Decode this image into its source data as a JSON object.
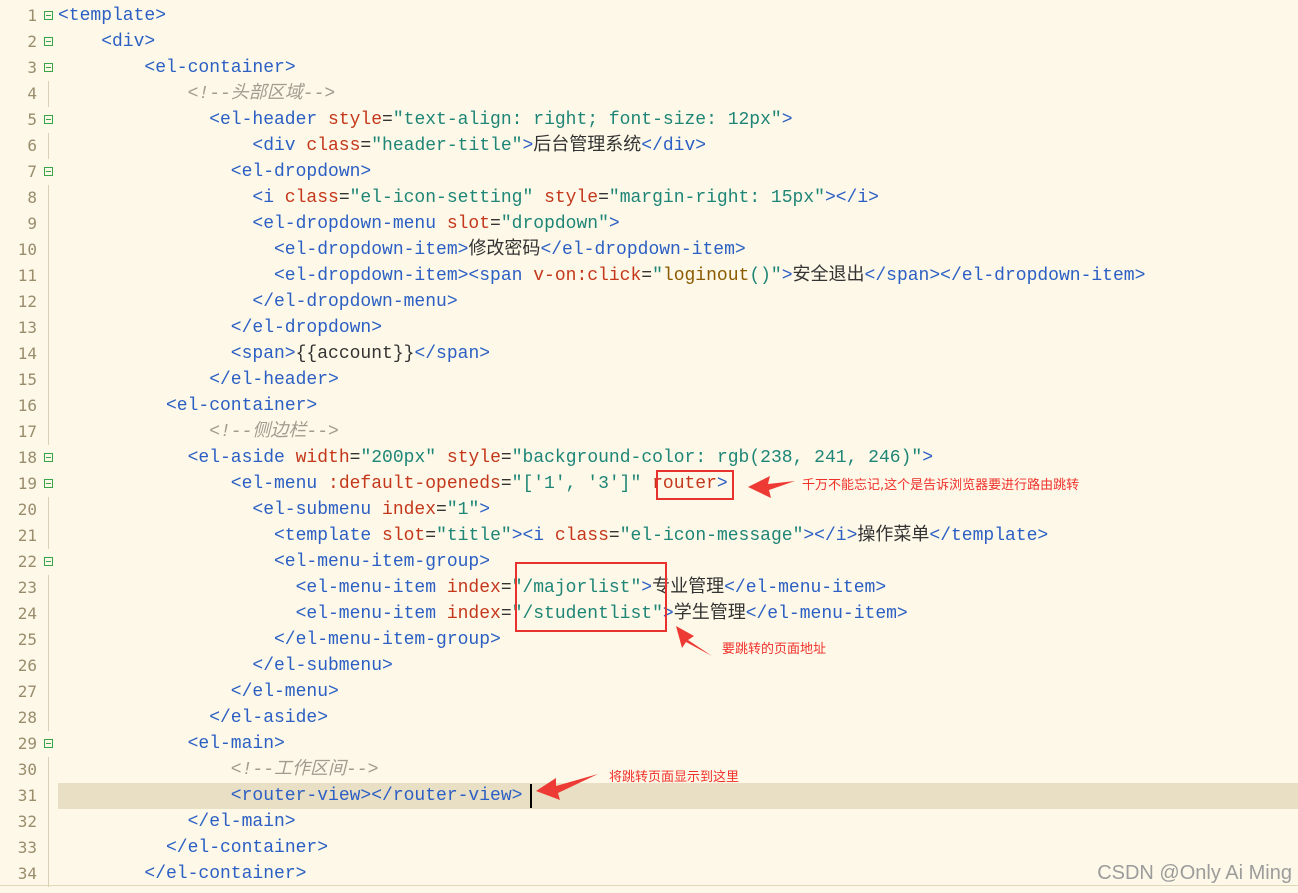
{
  "editor": {
    "current_line": 31,
    "lines": [
      {
        "n": "1",
        "fold": true,
        "indent": 0,
        "tokens": [
          [
            "tag",
            "<template>"
          ]
        ]
      },
      {
        "n": "2",
        "fold": true,
        "indent": 4,
        "tokens": [
          [
            "tag",
            "<div>"
          ]
        ]
      },
      {
        "n": "3",
        "fold": true,
        "indent": 8,
        "tokens": [
          [
            "tag",
            "<el-container>"
          ]
        ]
      },
      {
        "n": "4",
        "fold": false,
        "indent": 12,
        "tokens": [
          [
            "com",
            "<!--头部区域-->"
          ]
        ]
      },
      {
        "n": "5",
        "fold": true,
        "indent": 14,
        "tokens": [
          [
            "tag",
            "<el-header "
          ],
          [
            "attr",
            "style"
          ],
          [
            "txt",
            "="
          ],
          [
            "str",
            "\"text-align: right; font-size: 12px\""
          ],
          [
            "tag",
            ">"
          ]
        ]
      },
      {
        "n": "6",
        "fold": false,
        "indent": 18,
        "tokens": [
          [
            "tag",
            "<div "
          ],
          [
            "attr",
            "class"
          ],
          [
            "txt",
            "="
          ],
          [
            "str",
            "\"header-title\""
          ],
          [
            "tag",
            ">"
          ],
          [
            "txt",
            "后台管理系统"
          ],
          [
            "tag",
            "</div>"
          ]
        ]
      },
      {
        "n": "7",
        "fold": true,
        "indent": 16,
        "tokens": [
          [
            "tag",
            "<el-dropdown>"
          ]
        ]
      },
      {
        "n": "8",
        "fold": false,
        "indent": 18,
        "tokens": [
          [
            "tag",
            "<i "
          ],
          [
            "attr",
            "class"
          ],
          [
            "txt",
            "="
          ],
          [
            "str",
            "\"el-icon-setting\""
          ],
          [
            "tag",
            " "
          ],
          [
            "attr",
            "style"
          ],
          [
            "txt",
            "="
          ],
          [
            "str",
            "\"margin-right: 15px\""
          ],
          [
            "tag",
            "></i>"
          ]
        ]
      },
      {
        "n": "9",
        "fold": false,
        "indent": 18,
        "tokens": [
          [
            "tag",
            "<el-dropdown-menu "
          ],
          [
            "attr",
            "slot"
          ],
          [
            "txt",
            "="
          ],
          [
            "str",
            "\"dropdown\""
          ],
          [
            "tag",
            ">"
          ]
        ]
      },
      {
        "n": "10",
        "fold": false,
        "indent": 20,
        "tokens": [
          [
            "tag",
            "<el-dropdown-item>"
          ],
          [
            "txt",
            "修改密码"
          ],
          [
            "tag",
            "</el-dropdown-item>"
          ]
        ]
      },
      {
        "n": "11",
        "fold": false,
        "indent": 20,
        "tokens": [
          [
            "tag",
            "<el-dropdown-item><span "
          ],
          [
            "attr",
            "v-on:click"
          ],
          [
            "txt",
            "="
          ],
          [
            "str",
            "\""
          ],
          [
            "fn",
            "loginout"
          ],
          [
            "str",
            "()\""
          ],
          [
            "tag",
            ">"
          ],
          [
            "txt",
            "安全退出"
          ],
          [
            "tag",
            "</span></el-dropdown-item>"
          ]
        ]
      },
      {
        "n": "12",
        "fold": false,
        "indent": 18,
        "tokens": [
          [
            "tag",
            "</el-dropdown-menu>"
          ]
        ]
      },
      {
        "n": "13",
        "fold": false,
        "indent": 16,
        "tokens": [
          [
            "tag",
            "</el-dropdown>"
          ]
        ]
      },
      {
        "n": "14",
        "fold": false,
        "indent": 16,
        "tokens": [
          [
            "tag",
            "<span>"
          ],
          [
            "txt",
            "{{account}}"
          ],
          [
            "tag",
            "</span>"
          ]
        ]
      },
      {
        "n": "15",
        "fold": false,
        "indent": 14,
        "tokens": [
          [
            "tag",
            "</el-header>"
          ]
        ]
      },
      {
        "n": "16",
        "fold": false,
        "indent": 10,
        "tokens": [
          [
            "tag",
            "<el-container>"
          ]
        ]
      },
      {
        "n": "17",
        "fold": false,
        "indent": 14,
        "tokens": [
          [
            "com",
            "<!--侧边栏-->"
          ]
        ]
      },
      {
        "n": "18",
        "fold": true,
        "indent": 12,
        "tokens": [
          [
            "tag",
            "<el-aside "
          ],
          [
            "attr",
            "width"
          ],
          [
            "txt",
            "="
          ],
          [
            "str",
            "\"200px\""
          ],
          [
            "tag",
            " "
          ],
          [
            "attr",
            "style"
          ],
          [
            "txt",
            "="
          ],
          [
            "str",
            "\"background-color: rgb(238, 241, 246)\""
          ],
          [
            "tag",
            ">"
          ]
        ]
      },
      {
        "n": "19",
        "fold": true,
        "indent": 16,
        "tokens": [
          [
            "tag",
            "<el-menu "
          ],
          [
            "attr",
            ":default-openeds"
          ],
          [
            "txt",
            "="
          ],
          [
            "str",
            "\"['1', '3']\""
          ],
          [
            "tag",
            " "
          ],
          [
            "attr",
            "router"
          ],
          [
            "tag",
            ">"
          ]
        ]
      },
      {
        "n": "20",
        "fold": false,
        "indent": 18,
        "tokens": [
          [
            "tag",
            "<el-submenu "
          ],
          [
            "attr",
            "index"
          ],
          [
            "txt",
            "="
          ],
          [
            "str",
            "\"1\""
          ],
          [
            "tag",
            ">"
          ]
        ]
      },
      {
        "n": "21",
        "fold": false,
        "indent": 20,
        "tokens": [
          [
            "tag",
            "<template "
          ],
          [
            "attr",
            "slot"
          ],
          [
            "txt",
            "="
          ],
          [
            "str",
            "\"title\""
          ],
          [
            "tag",
            "><i "
          ],
          [
            "attr",
            "class"
          ],
          [
            "txt",
            "="
          ],
          [
            "str",
            "\"el-icon-message\""
          ],
          [
            "tag",
            "></i>"
          ],
          [
            "txt",
            "操作菜单"
          ],
          [
            "tag",
            "</template>"
          ]
        ]
      },
      {
        "n": "22",
        "fold": true,
        "indent": 20,
        "tokens": [
          [
            "tag",
            "<el-menu-item-group>"
          ]
        ]
      },
      {
        "n": "23",
        "fold": false,
        "indent": 22,
        "tokens": [
          [
            "tag",
            "<el-menu-item "
          ],
          [
            "attr",
            "index"
          ],
          [
            "txt",
            "="
          ],
          [
            "str",
            "\"/majorlist\""
          ],
          [
            "tag",
            ">"
          ],
          [
            "txt",
            "专业管理"
          ],
          [
            "tag",
            "</el-menu-item>"
          ]
        ]
      },
      {
        "n": "24",
        "fold": false,
        "indent": 22,
        "tokens": [
          [
            "tag",
            "<el-menu-item "
          ],
          [
            "attr",
            "index"
          ],
          [
            "txt",
            "="
          ],
          [
            "str",
            "\"/studentlist\""
          ],
          [
            "tag",
            ">"
          ],
          [
            "txt",
            "学生管理"
          ],
          [
            "tag",
            "</el-menu-item>"
          ]
        ]
      },
      {
        "n": "25",
        "fold": false,
        "indent": 20,
        "tokens": [
          [
            "tag",
            "</el-menu-item-group>"
          ]
        ]
      },
      {
        "n": "26",
        "fold": false,
        "indent": 18,
        "tokens": [
          [
            "tag",
            "</el-submenu>"
          ]
        ]
      },
      {
        "n": "27",
        "fold": false,
        "indent": 16,
        "tokens": [
          [
            "tag",
            "</el-menu>"
          ]
        ]
      },
      {
        "n": "28",
        "fold": false,
        "indent": 14,
        "tokens": [
          [
            "tag",
            "</el-aside>"
          ]
        ]
      },
      {
        "n": "29",
        "fold": true,
        "indent": 12,
        "tokens": [
          [
            "tag",
            "<el-main>"
          ]
        ]
      },
      {
        "n": "30",
        "fold": false,
        "indent": 16,
        "tokens": [
          [
            "com",
            "<!--工作区间-->"
          ]
        ]
      },
      {
        "n": "31",
        "fold": false,
        "indent": 16,
        "tokens": [
          [
            "tag",
            "<router-view></router-view>"
          ]
        ]
      },
      {
        "n": "32",
        "fold": false,
        "indent": 12,
        "tokens": [
          [
            "tag",
            "</el-main>"
          ]
        ]
      },
      {
        "n": "33",
        "fold": false,
        "indent": 10,
        "tokens": [
          [
            "tag",
            "</el-container>"
          ]
        ]
      },
      {
        "n": "34",
        "fold": false,
        "indent": 8,
        "tokens": [
          [
            "tag",
            "</el-container>"
          ]
        ]
      }
    ]
  },
  "annotations": {
    "router_note": "千万不能忘记,这个是告诉浏览器要进行路由跳转",
    "path_note": "要跳转的页面地址",
    "view_note": "将跳转页面显示到这里",
    "color": "#e8322e"
  },
  "watermark": "CSDN @Only Ai Ming"
}
